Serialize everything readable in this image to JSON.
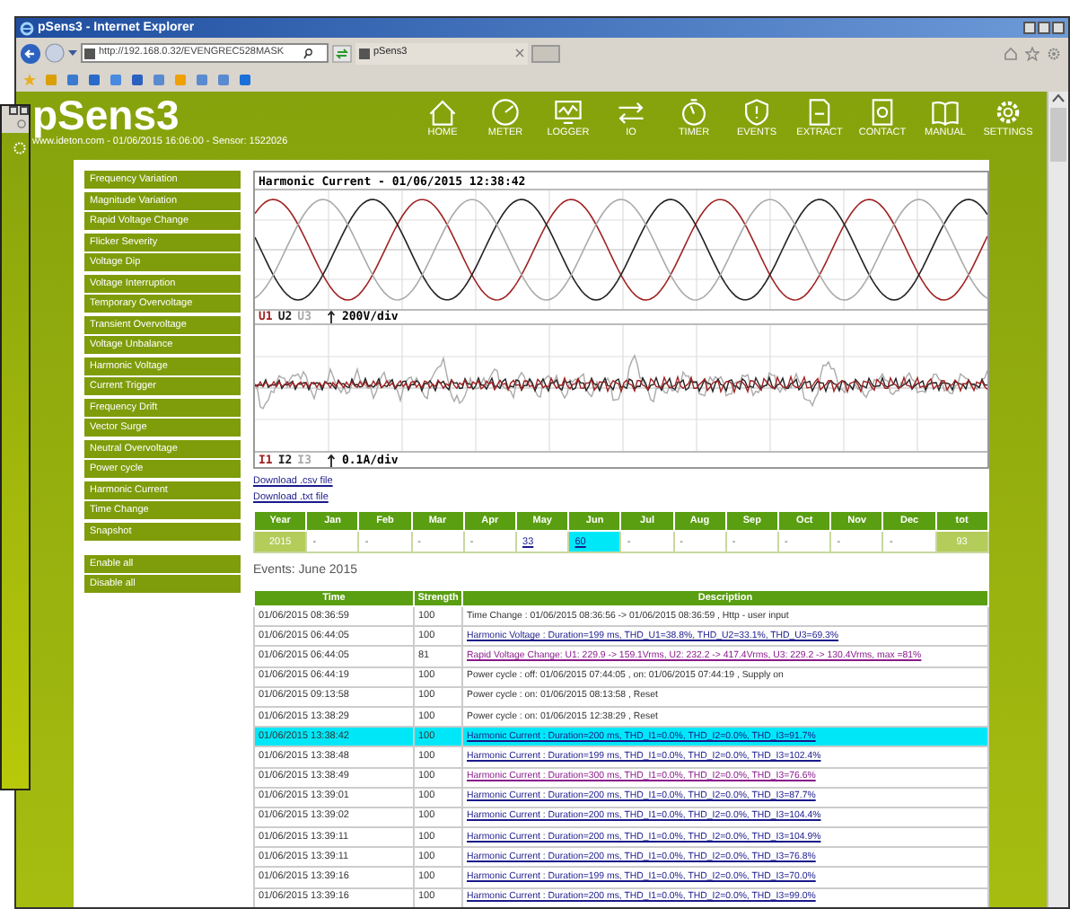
{
  "browser": {
    "title": "pSens3 - Internet Explorer",
    "address": "http://192.168.0.32/EVENGREC528MASK",
    "tab_title": "pSens3"
  },
  "header": {
    "logo": "pSens3",
    "subtitle": "www.ideton.com - 01/06/2015 16:06:00 - Sensor: 1522026",
    "nav": [
      {
        "label": "HOME"
      },
      {
        "label": "METER"
      },
      {
        "label": "LOGGER"
      },
      {
        "label": "IO"
      },
      {
        "label": "TIMER"
      },
      {
        "label": "EVENTS"
      },
      {
        "label": "EXTRACT"
      },
      {
        "label": "CONTACT"
      },
      {
        "label": "MANUAL"
      },
      {
        "label": "SETTINGS"
      }
    ]
  },
  "menu": [
    "Frequency Variation",
    "Magnitude Variation",
    "Rapid Voltage Change",
    "Flicker Severity",
    "Voltage Dip",
    "Voltage Interruption",
    "Temporary Overvoltage",
    "Transient Overvoltage",
    "Voltage Unbalance",
    "Harmonic Voltage",
    "Current Trigger",
    "Frequency Drift",
    "Vector Surge",
    "Neutral Overvoltage",
    "Power cycle",
    "Harmonic Current",
    "Time Change",
    "Snapshot"
  ],
  "menu_actions": [
    "Enable all",
    "Disable all"
  ],
  "chart": {
    "title": "Harmonic Current - 01/06/2015 12:38:42",
    "upper_legend": [
      {
        "label": "U1",
        "color": "#a02222"
      },
      {
        "label": "U2",
        "color": "#222222"
      },
      {
        "label": "U3",
        "color": "#aaaaaa"
      }
    ],
    "upper_scale": "200V/div",
    "lower_legend": [
      {
        "label": "I1",
        "color": "#a02222"
      },
      {
        "label": "I2",
        "color": "#222222"
      },
      {
        "label": "I3",
        "color": "#aaaaaa"
      }
    ],
    "lower_scale": "0.1A/div"
  },
  "downloads": [
    "Download .csv file",
    "Download .txt file"
  ],
  "year_table": {
    "columns": [
      "Year",
      "Jan",
      "Feb",
      "Mar",
      "Apr",
      "May",
      "Jun",
      "Jul",
      "Aug",
      "Sep",
      "Oct",
      "Nov",
      "Dec",
      "tot"
    ],
    "rows": [
      {
        "cells": [
          {
            "text": "2015",
            "kind": "label",
            "selected": false
          },
          {
            "text": "-",
            "kind": "text",
            "selected": false
          },
          {
            "text": "-",
            "kind": "text",
            "selected": false
          },
          {
            "text": "-",
            "kind": "text",
            "selected": false
          },
          {
            "text": "-",
            "kind": "text",
            "selected": false
          },
          {
            "text": "33",
            "kind": "link",
            "selected": false
          },
          {
            "text": "60",
            "kind": "link",
            "selected": true
          },
          {
            "text": "-",
            "kind": "text",
            "selected": false
          },
          {
            "text": "-",
            "kind": "text",
            "selected": false
          },
          {
            "text": "-",
            "kind": "text",
            "selected": false
          },
          {
            "text": "-",
            "kind": "text",
            "selected": false
          },
          {
            "text": "-",
            "kind": "text",
            "selected": false
          },
          {
            "text": "-",
            "kind": "text",
            "selected": false
          },
          {
            "text": "93",
            "kind": "label",
            "selected": false
          }
        ]
      }
    ]
  },
  "events": {
    "title": "Events: June 2015",
    "columns": [
      "Time",
      "Strength",
      "Description"
    ],
    "rows": [
      {
        "time": "01/06/2015 08:36:59",
        "strength": "100",
        "description": "Time Change : 01/06/2015 08:36:56 -> 01/06/2015 08:36:59 , Http - user input",
        "kind": "text",
        "selected": false
      },
      {
        "time": "01/06/2015 06:44:05",
        "strength": "100",
        "description": "Harmonic Voltage : Duration=199 ms, THD_U1=38.8%, THD_U2=33.1%, THD_U3=69.3%",
        "kind": "link",
        "selected": false
      },
      {
        "time": "01/06/2015 06:44:05",
        "strength": "81",
        "description": "Rapid Voltage Change: U1: 229.9 -> 159.1Vrms, U2: 232.2 -> 417.4Vrms, U3: 229.2 -> 130.4Vrms, max =81%",
        "kind": "visited",
        "selected": false
      },
      {
        "time": "01/06/2015 06:44:19",
        "strength": "100",
        "description": "Power cycle : off: 01/06/2015 07:44:05 , on: 01/06/2015 07:44:19 , Supply on",
        "kind": "text",
        "selected": false
      },
      {
        "time": "01/06/2015 09:13:58",
        "strength": "100",
        "description": "Power cycle : on: 01/06/2015 08:13:58 , Reset",
        "kind": "text",
        "selected": false
      },
      {
        "time": "01/06/2015 13:38:29",
        "strength": "100",
        "description": "Power cycle : on: 01/06/2015 12:38:29 , Reset",
        "kind": "text",
        "selected": false
      },
      {
        "time": "01/06/2015 13:38:42",
        "strength": "100",
        "description": "Harmonic Current : Duration=200 ms, THD_I1=0.0%, THD_I2=0.0%, THD_I3=91.7%",
        "kind": "link",
        "selected": true
      },
      {
        "time": "01/06/2015 13:38:48",
        "strength": "100",
        "description": "Harmonic Current : Duration=199 ms, THD_I1=0.0%, THD_I2=0.0%, THD_I3=102.4%",
        "kind": "link",
        "selected": false
      },
      {
        "time": "01/06/2015 13:38:49",
        "strength": "100",
        "description": "Harmonic Current : Duration=300 ms, THD_I1=0.0%, THD_I2=0.0%, THD_I3=76.6%",
        "kind": "visited",
        "selected": false
      },
      {
        "time": "01/06/2015 13:39:01",
        "strength": "100",
        "description": "Harmonic Current : Duration=200 ms, THD_I1=0.0%, THD_I2=0.0%, THD_I3=87.7%",
        "kind": "link",
        "selected": false
      },
      {
        "time": "01/06/2015 13:39:02",
        "strength": "100",
        "description": "Harmonic Current : Duration=200 ms, THD_I1=0.0%, THD_I2=0.0%, THD_I3=104.4%",
        "kind": "link",
        "selected": false
      },
      {
        "time": "01/06/2015 13:39:11",
        "strength": "100",
        "description": "Harmonic Current : Duration=200 ms, THD_I1=0.0%, THD_I2=0.0%, THD_I3=104.9%",
        "kind": "link",
        "selected": false
      },
      {
        "time": "01/06/2015 13:39:11",
        "strength": "100",
        "description": "Harmonic Current : Duration=200 ms, THD_I1=0.0%, THD_I2=0.0%, THD_I3=76.8%",
        "kind": "link",
        "selected": false
      },
      {
        "time": "01/06/2015 13:39:16",
        "strength": "100",
        "description": "Harmonic Current : Duration=199 ms, THD_I1=0.0%, THD_I2=0.0%, THD_I3=70.0%",
        "kind": "link",
        "selected": false
      },
      {
        "time": "01/06/2015 13:39:16",
        "strength": "100",
        "description": "Harmonic Current : Duration=200 ms, THD_I1=0.0%, THD_I2=0.0%, THD_I3=99.0%",
        "kind": "link",
        "selected": false
      }
    ]
  }
}
